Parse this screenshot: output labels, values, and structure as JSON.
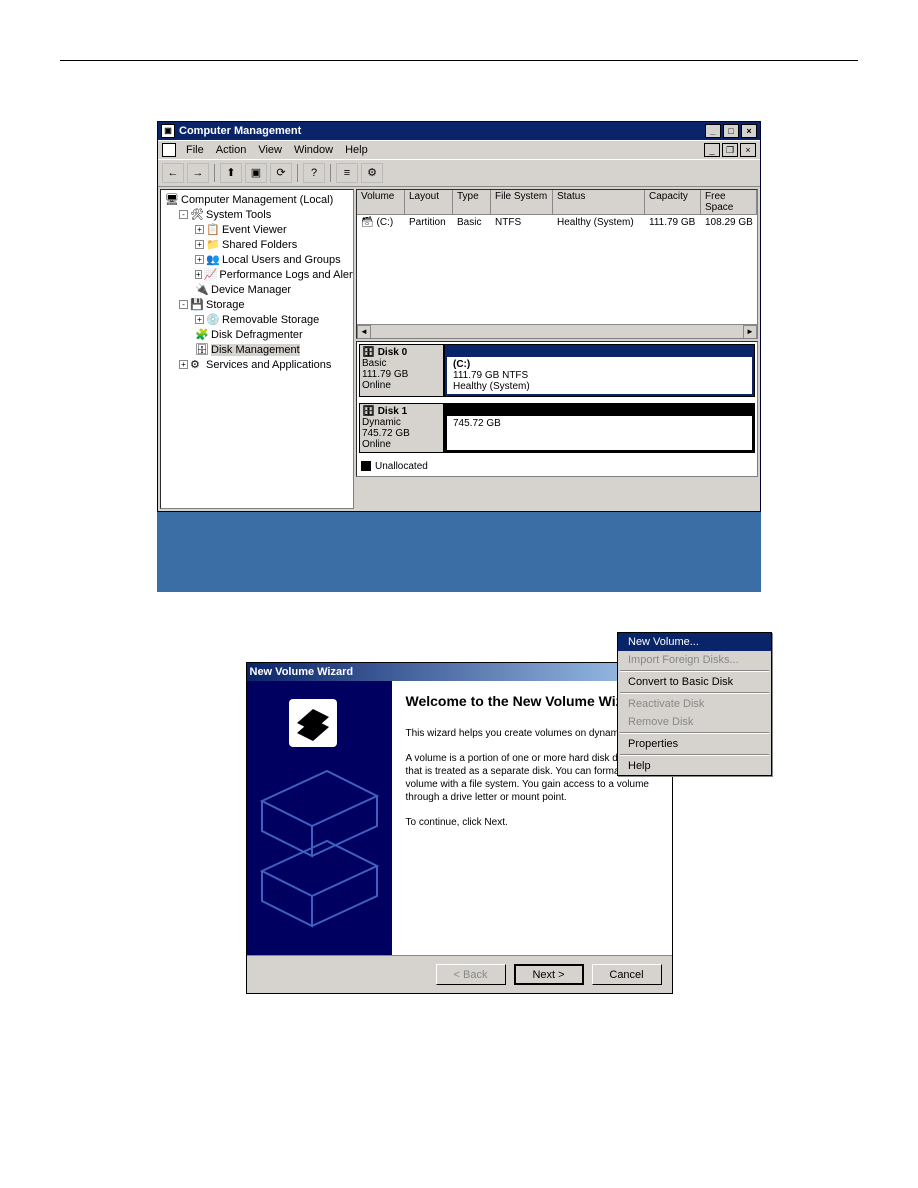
{
  "cm": {
    "title": "Computer Management",
    "menu": {
      "file": "File",
      "action": "Action",
      "view": "View",
      "window": "Window",
      "help": "Help"
    },
    "tree": {
      "root": "Computer Management (Local)",
      "system_tools": "System Tools",
      "event_viewer": "Event Viewer",
      "shared_folders": "Shared Folders",
      "local_users": "Local Users and Groups",
      "perf_logs": "Performance Logs and Alerts",
      "device_mgr": "Device Manager",
      "storage": "Storage",
      "removable": "Removable Storage",
      "defrag": "Disk Defragmenter",
      "diskmgmt": "Disk Management",
      "services": "Services and Applications"
    },
    "vol_headers": {
      "volume": "Volume",
      "layout": "Layout",
      "type": "Type",
      "fs": "File System",
      "status": "Status",
      "capacity": "Capacity",
      "free": "Free Space"
    },
    "vol_row": {
      "volume": "(C:)",
      "layout": "Partition",
      "type": "Basic",
      "fs": "NTFS",
      "status": "Healthy (System)",
      "capacity": "111.79 GB",
      "free": "108.29 GB"
    },
    "disk0": {
      "name": "Disk 0",
      "type": "Basic",
      "size": "111.79 GB",
      "state": "Online",
      "pname": "(C:)",
      "pdetail": "111.79 GB NTFS",
      "pstatus": "Healthy (System)"
    },
    "disk1": {
      "name": "Disk 1",
      "type": "Dynamic",
      "size": "745.72 GB",
      "state": "Online",
      "pdetail": "745.72 GB"
    },
    "legend": "Unallocated",
    "ctx": {
      "new_volume": "New Volume...",
      "import": "Import Foreign Disks...",
      "convert": "Convert to Basic Disk",
      "reactivate": "Reactivate Disk",
      "remove": "Remove Disk",
      "properties": "Properties",
      "help": "Help"
    }
  },
  "nvw": {
    "title": "New Volume Wizard",
    "heading": "Welcome to the New Volume Wizard",
    "p1": "This wizard helps you create volumes on dynamic disks.",
    "p2": "A volume is a portion of one or more hard disk drives that is treated as a separate disk. You can format a volume with a file system. You gain access to a volume through a drive letter or mount point.",
    "p3": "To continue, click Next.",
    "back": "< Back",
    "next": "Next >",
    "cancel": "Cancel"
  }
}
